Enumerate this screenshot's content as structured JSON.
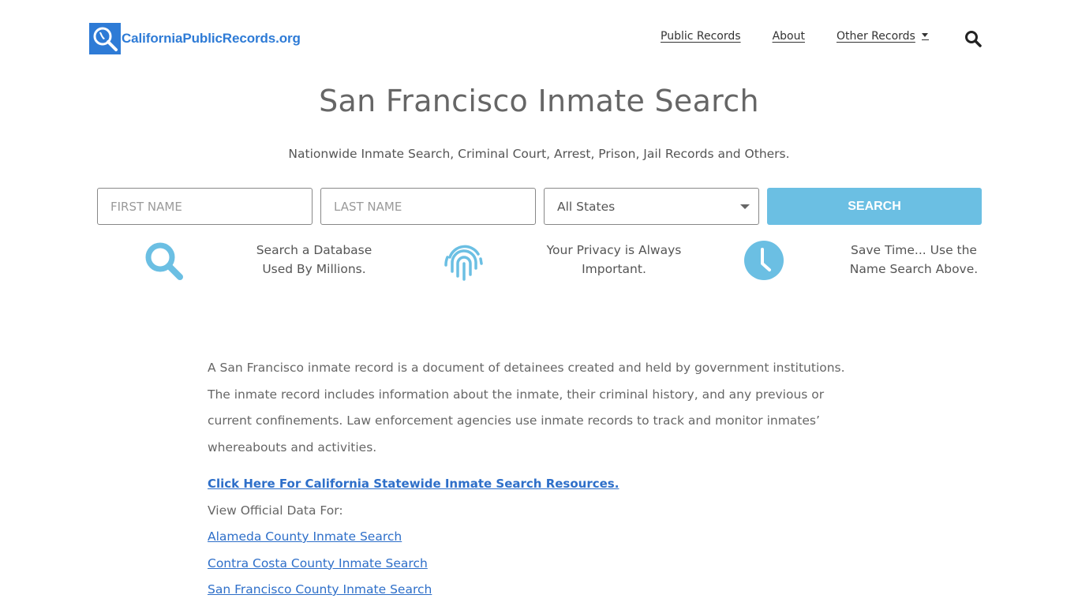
{
  "header": {
    "logo_text": "CaliforniaPublicRecords.org",
    "logo_icon": "magnifier-california-icon",
    "nav": [
      {
        "label": "Public Records"
      },
      {
        "label": "About"
      },
      {
        "label": "Other Records",
        "has_dropdown": true
      }
    ],
    "search_icon": "search-icon"
  },
  "page": {
    "title": "San Francisco Inmate Search",
    "subtitle": "Nationwide Inmate Search, Criminal Court, Arrest, Prison, Jail Records and Others."
  },
  "search_form": {
    "first_name_placeholder": "FIRST NAME",
    "first_name_value": "",
    "last_name_placeholder": "LAST NAME",
    "last_name_value": "",
    "state_selected": "All States",
    "search_label": "SEARCH"
  },
  "features": [
    {
      "icon": "search-icon",
      "line1": "Search a Database",
      "line2": "Used By Millions."
    },
    {
      "icon": "fingerprint-icon",
      "line1": "Your Privacy is Always",
      "line2": "Important."
    },
    {
      "icon": "clock-icon",
      "line1": "Save Time... Use the",
      "line2": "Name Search Above."
    }
  ],
  "content": {
    "paragraph": "A San Francisco inmate record is a document of detainees created and held by government institutions. The inmate record includes information about the inmate, their criminal history, and any previous or current confinements. Law enforcement agencies use inmate records to track and monitor inmates’ whereabouts and activities.",
    "statewide_link": "Click Here For California Statewide Inmate Search Resources.",
    "view_label": "View Official Data For:",
    "county_links": [
      "Alameda County Inmate Search",
      "Contra Costa County Inmate Search",
      "San Francisco County Inmate Search"
    ]
  },
  "colors": {
    "brand_blue": "#2e7bd6",
    "accent_light_blue": "#6bbfe3",
    "link_blue": "#2e6fc9",
    "text_gray": "#666666"
  }
}
